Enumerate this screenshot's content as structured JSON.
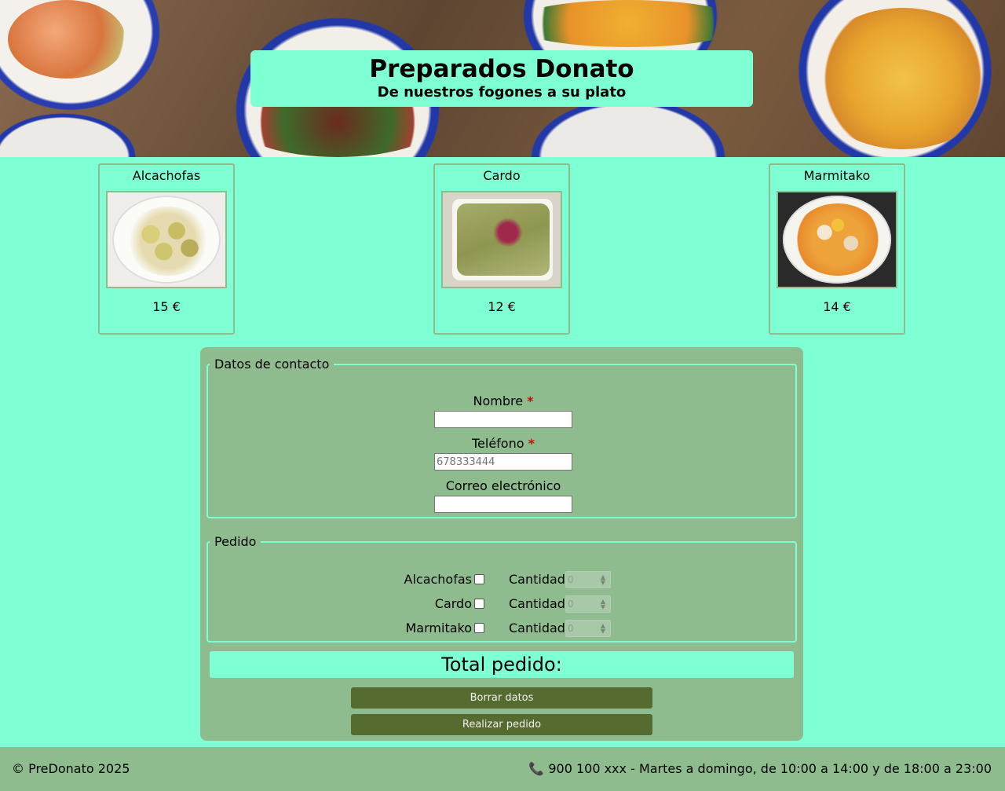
{
  "header": {
    "title": "Preparados Donato",
    "subtitle": "De nuestros fogones a su plato"
  },
  "products": [
    {
      "name": "Alcachofas",
      "price": "15 €",
      "image": "artichoke-dish-photo"
    },
    {
      "name": "Cardo",
      "price": "12 €",
      "image": "cardoon-dish-photo"
    },
    {
      "name": "Marmitako",
      "price": "14 €",
      "image": "marmitako-dish-photo"
    }
  ],
  "form": {
    "contact_legend": "Datos de contacto",
    "name_label": "Nombre",
    "name_value": "",
    "phone_label": "Teléfono",
    "phone_placeholder": "678333444",
    "email_label": "Correo electrónico",
    "email_value": "",
    "required_mark": "*",
    "order_legend": "Pedido",
    "quantity_label": "Cantidad",
    "order_items": [
      {
        "name": "Alcachofas",
        "checked": false,
        "quantity": "0"
      },
      {
        "name": "Cardo",
        "checked": false,
        "quantity": "0"
      },
      {
        "name": "Marmitako",
        "checked": false,
        "quantity": "0"
      }
    ],
    "total_label": "Total pedido:",
    "clear_button": "Borrar datos",
    "submit_button": "Realizar pedido"
  },
  "footer": {
    "copyright": "© PreDonato 2025",
    "contact": "📞 900 100 xxx - Martes a domingo, de 10:00 a 14:00 y de 18:00 a 23:00"
  },
  "colors": {
    "background": "#7fffd4",
    "panel": "#8fbc8f",
    "button": "#556b2f",
    "required": "#e00000"
  }
}
